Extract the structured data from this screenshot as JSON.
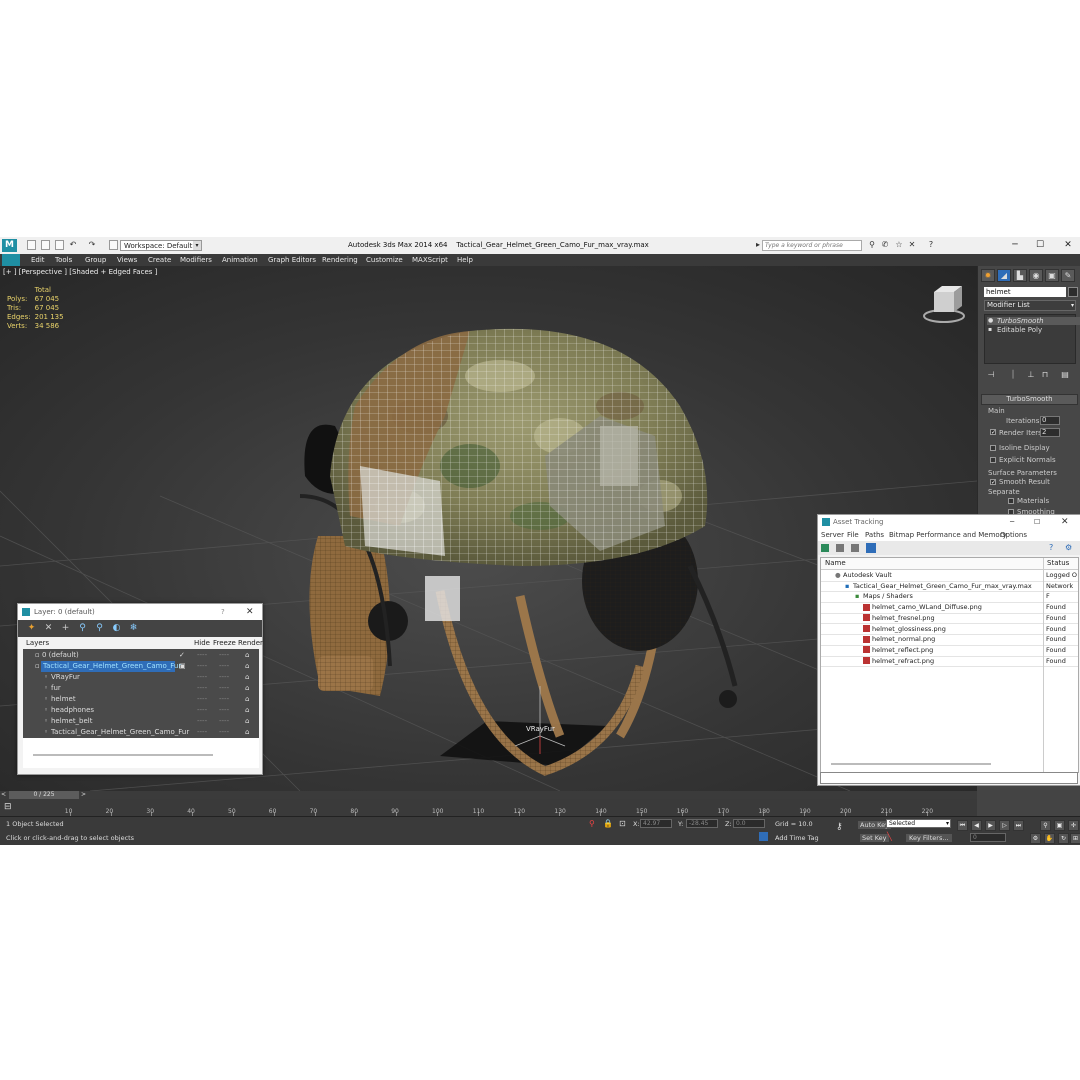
{
  "app": {
    "title": "Autodesk 3ds Max  2014 x64",
    "file": "Tactical_Gear_Helmet_Green_Camo_Fur_max_vray.max",
    "workspace": "Workspace: Default",
    "search_placeholder": "Type a keyword or phrase"
  },
  "menu": [
    "Edit",
    "Tools",
    "Group",
    "Views",
    "Create",
    "Modifiers",
    "Animation",
    "Graph Editors",
    "Rendering",
    "Customize",
    "MAXScript",
    "Help"
  ],
  "viewport": {
    "label": "[+ ] [Perspective ] [Shaded + Edged Faces ]",
    "stats_header": "Total",
    "stats": [
      {
        "label": "Polys:",
        "value": "67 045"
      },
      {
        "label": "Tris:",
        "value": "67 045"
      },
      {
        "label": "Edges:",
        "value": "201 135"
      },
      {
        "label": "Verts:",
        "value": "34 586"
      }
    ],
    "object_label": "VRayFur"
  },
  "command_panel": {
    "object_name": "helmet",
    "modifier_list": "Modifier List",
    "stack": [
      "TurboSmooth",
      "Editable Poly"
    ],
    "rollout_title": "TurboSmooth",
    "group_main": "Main",
    "iterations_label": "Iterations:",
    "iterations_value": "0",
    "render_iters_label": "Render Iters:",
    "render_iters_value": "2",
    "isoline_label": "Isoline Display",
    "explicit_normals_label": "Explicit Normals",
    "surface_params_label": "Surface Parameters",
    "smooth_result_label": "Smooth Result",
    "separate_label": "Separate",
    "materials_label": "Materials",
    "smoothing_groups_label": "Smoothing Groups"
  },
  "layers": {
    "title": "Layer: 0 (default)",
    "help": "?",
    "columns": [
      "Layers",
      "Hide",
      "Freeze",
      "Render"
    ],
    "rows": [
      {
        "name": "0 (default)",
        "indent": 1
      },
      {
        "name": "Tactical_Gear_Helmet_Green_Camo_Fur",
        "indent": 1
      },
      {
        "name": "VRayFur",
        "indent": 2
      },
      {
        "name": "fur",
        "indent": 2
      },
      {
        "name": "helmet",
        "indent": 2
      },
      {
        "name": "headphones",
        "indent": 2
      },
      {
        "name": "helmet_belt",
        "indent": 2
      },
      {
        "name": "Tactical_Gear_Helmet_Green_Camo_Fur",
        "indent": 2
      }
    ],
    "dash": "----"
  },
  "asset_tracking": {
    "title": "Asset Tracking",
    "menu": [
      "Server",
      "File",
      "Paths",
      "Bitmap Performance and Memory",
      "Options"
    ],
    "columns": [
      "Name",
      "Status"
    ],
    "rows": [
      {
        "name": "Autodesk Vault",
        "status": "Logged O",
        "indent": 1,
        "kind": "vault"
      },
      {
        "name": "Tactical_Gear_Helmet_Green_Camo_Fur_max_vray.max",
        "status": "Network F",
        "indent": 2,
        "kind": "file"
      },
      {
        "name": "Maps / Shaders",
        "status": "",
        "indent": 3,
        "kind": "folder"
      },
      {
        "name": "helmet_camo_WLand_Diffuse.png",
        "status": "Found",
        "indent": 4,
        "kind": "png"
      },
      {
        "name": "helmet_fresnel.png",
        "status": "Found",
        "indent": 4,
        "kind": "png"
      },
      {
        "name": "helmet_glossiness.png",
        "status": "Found",
        "indent": 4,
        "kind": "png"
      },
      {
        "name": "helmet_normal.png",
        "status": "Found",
        "indent": 4,
        "kind": "png"
      },
      {
        "name": "helmet_reflect.png",
        "status": "Found",
        "indent": 4,
        "kind": "png"
      },
      {
        "name": "helmet_refract.png",
        "status": "Found",
        "indent": 4,
        "kind": "png"
      }
    ]
  },
  "timeline": {
    "frame": "0 / 225",
    "ticks": [
      "10",
      "20",
      "30",
      "40",
      "50",
      "60",
      "70",
      "80",
      "90",
      "100",
      "110",
      "120",
      "130",
      "140",
      "150",
      "160",
      "170",
      "180",
      "190",
      "200",
      "210",
      "220"
    ]
  },
  "status": {
    "selected": "1 Object Selected",
    "prompt": "Click or click-and-drag to select objects",
    "x_label": "X:",
    "x_value": "42.97",
    "y_label": "Y:",
    "y_value": "-28.45",
    "z_label": "Z:",
    "z_value": "0.0",
    "grid": "Grid = 10.0",
    "add_time_tag": "Add Time Tag",
    "auto_key": "Auto Key",
    "auto_key_value": "Selected",
    "set_key": "Set Key",
    "key_filters": "Key Filters...",
    "frame_value": "0"
  },
  "colors": {
    "accent": "#1f8fa3",
    "selection": "#2f6db8",
    "stats_text": "#e9d36a",
    "camo_base": "#8d8a5e"
  }
}
